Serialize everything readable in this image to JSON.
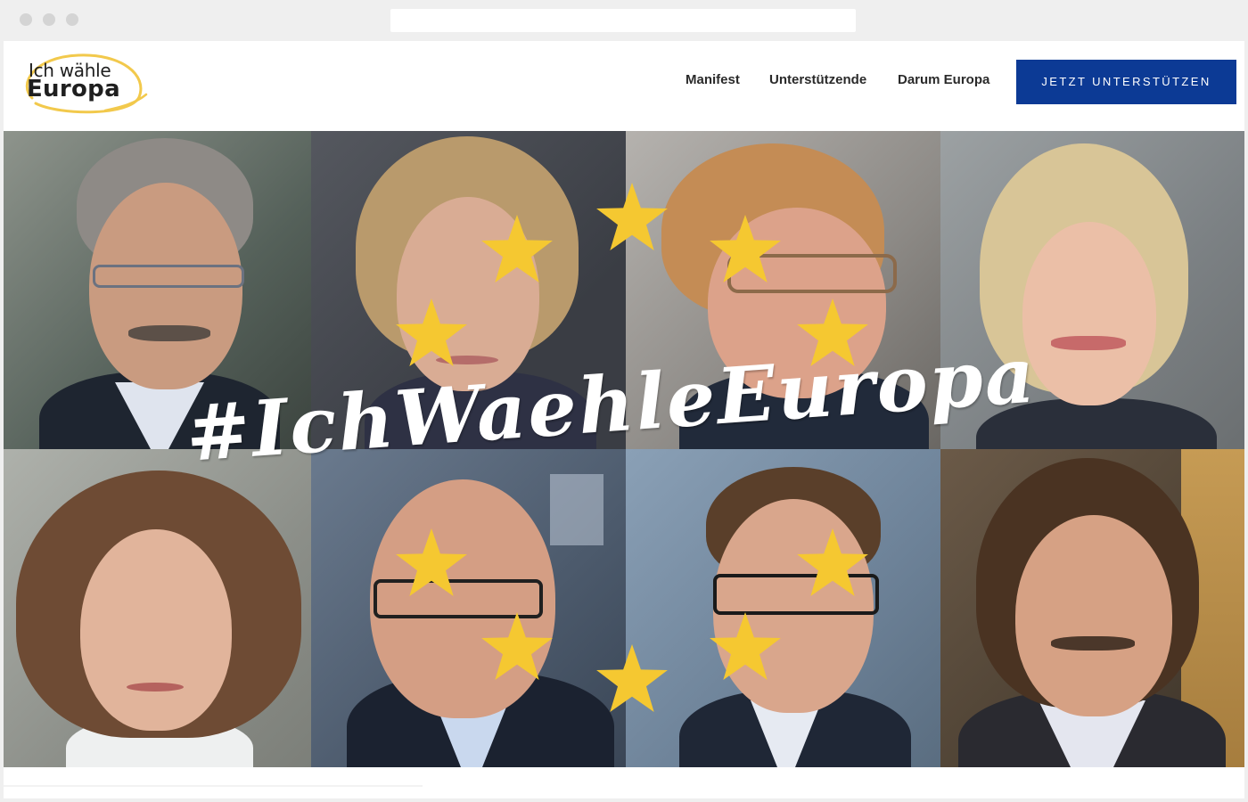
{
  "logo": {
    "line1": "Ich wähle",
    "line2": "Europa"
  },
  "nav": {
    "items": [
      {
        "label": "Manifest"
      },
      {
        "label": "Unterstützende"
      },
      {
        "label": "Darum Europa"
      }
    ],
    "cta_label": "JETZT UNTERSTÜTZEN"
  },
  "hero": {
    "hashtag": "#IchWaehleEuropa",
    "portrait_count": 8
  },
  "colors": {
    "cta_background": "#0c3a95",
    "star": "#f5c831",
    "logo_ring": "#f2c94c"
  },
  "icons": [
    "eu-star-icon",
    "logo-ring-icon"
  ]
}
